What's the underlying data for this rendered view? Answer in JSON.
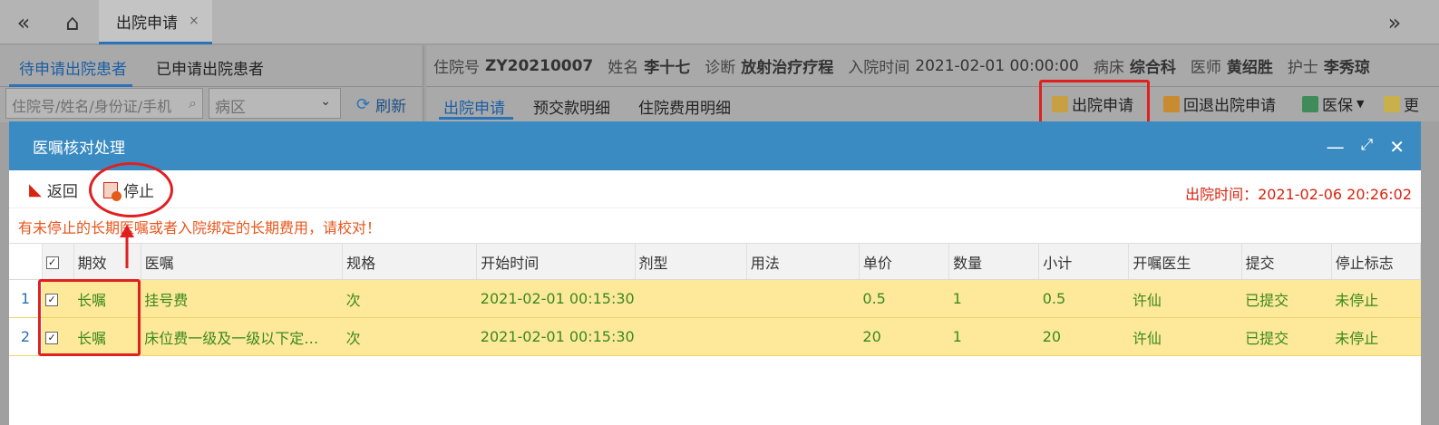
{
  "topbar": {
    "collapse_icon": "«",
    "home_icon": "⌂",
    "active_tab": "出院申请",
    "close_icon": "×",
    "expand_icon": "»"
  },
  "leftpanel": {
    "tabs": [
      "待申请出院患者",
      "已申请出院患者"
    ],
    "search_placeholder": "住院号/姓名/身份证/手机",
    "ward_placeholder": "病区",
    "refresh_label": "刷新"
  },
  "patient": {
    "items": [
      {
        "label": "住院号",
        "value": "ZY20210007"
      },
      {
        "label": "姓名",
        "value": "李十七"
      },
      {
        "label": "诊断",
        "value": "放射治疗疗程"
      },
      {
        "label": "入院时间",
        "value": "2021-02-01 00:00:00"
      },
      {
        "label": "病床",
        "value": "综合科"
      },
      {
        "label": "医师",
        "value": "黄绍胜"
      },
      {
        "label": "护士",
        "value": "李秀琼"
      }
    ]
  },
  "subtabs": [
    "出院申请",
    "预交款明细",
    "住院费用明细"
  ],
  "toolbar": {
    "discharge_apply": "出院申请",
    "revoke_apply": "回退出院申请",
    "insurance": "医保",
    "more": "更"
  },
  "modal": {
    "title": "医嘱核对处理",
    "back_label": "返回",
    "stop_label": "停止",
    "discharge_time": "出院时间：2021-02-06 20:26:02",
    "warning": "有未停止的长期医嘱或者入院绑定的长期费用，请校对！"
  },
  "table": {
    "columns": [
      "期效",
      "医嘱",
      "规格",
      "开始时间",
      "剂型",
      "用法",
      "单价",
      "数量",
      "小计",
      "开嘱医生",
      "提交",
      "停止标志"
    ],
    "rows": [
      [
        "1",
        "长嘱",
        "挂号费",
        "次",
        "2021-02-01 00:15:30",
        "",
        "",
        "0.5",
        "1",
        "0.5",
        "许仙",
        "已提交",
        "未停止"
      ],
      [
        "2",
        "长嘱",
        "床位费一级及一级以下定…",
        "次",
        "2021-02-01 00:15:30",
        "",
        "",
        "20",
        "1",
        "20",
        "许仙",
        "已提交",
        "未停止"
      ]
    ]
  },
  "colors": {
    "accent": "#2a73b8",
    "header": "#3b8bc3",
    "row_highlight": "#fee89a",
    "warning": "#e8561c",
    "annotation": "#e02020"
  }
}
